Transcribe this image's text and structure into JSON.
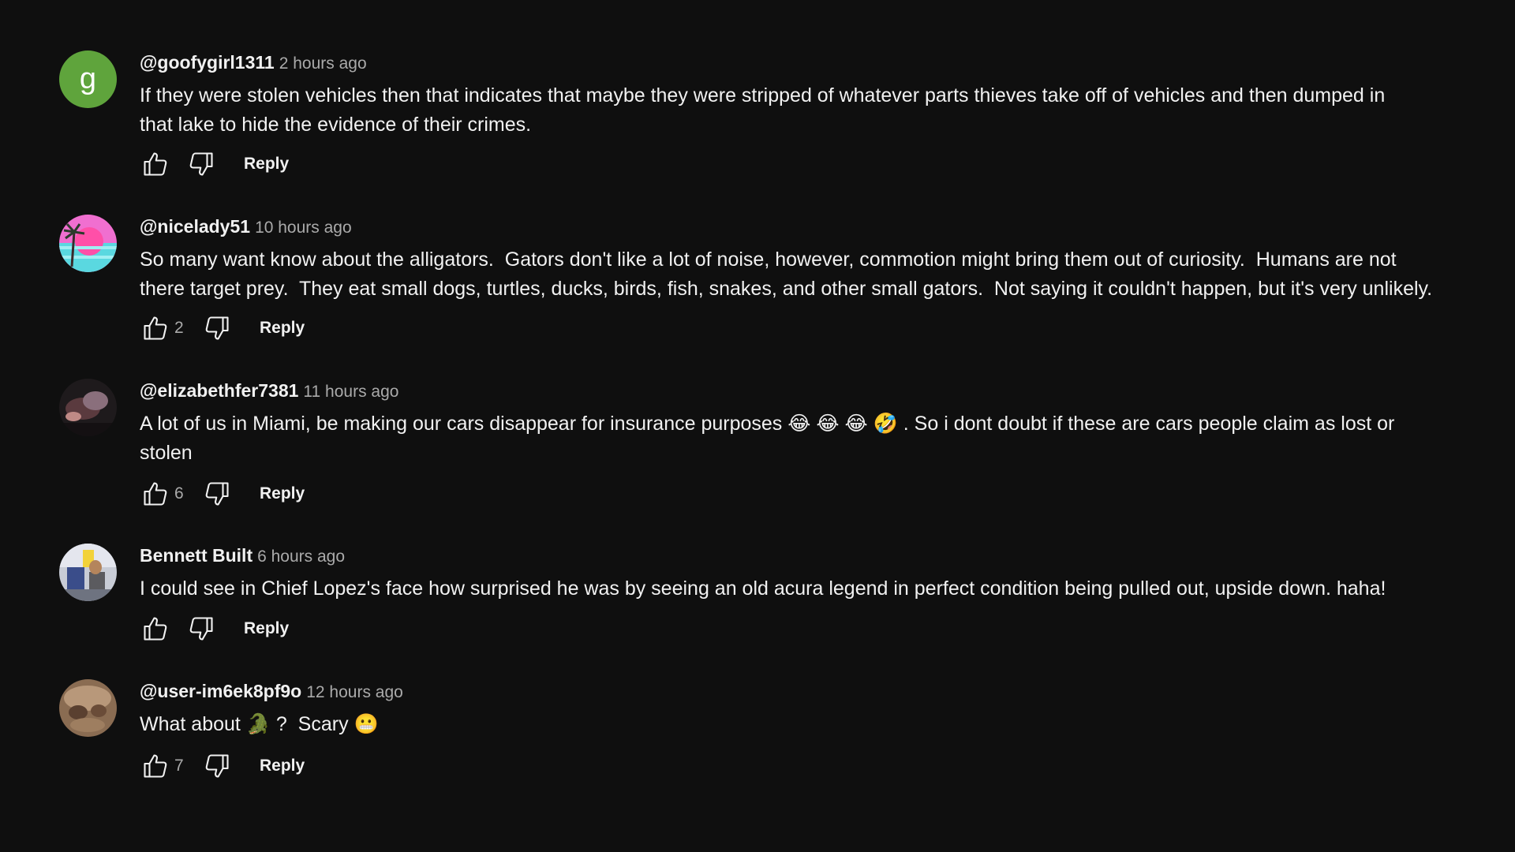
{
  "comments": [
    {
      "author": "@goofygirl1311",
      "time": "2 hours ago",
      "avatar_letter": "g",
      "text_lines": [
        "If they were stolen vehicles then that indicates that maybe they were stripped of whatever parts thieves take off of vehicles and then dumped in",
        "that lake to hide the evidence of their crimes."
      ],
      "like_count": "",
      "reply_label": "Reply"
    },
    {
      "author": "@nicelady51",
      "time": "10 hours ago",
      "text_lines": [
        "So many want know about the alligators.  Gators don't like a lot of noise, however, commotion might bring them out of curiosity.  Humans are not",
        "there target prey.  They eat small dogs, turtles, ducks, birds, fish, snakes, and other small gators.  Not saying it couldn't happen, but it's very unlikely."
      ],
      "like_count": "2",
      "reply_label": "Reply"
    },
    {
      "author": "@elizabethfer7381",
      "time": "11 hours ago",
      "text_lines": [
        "A lot of us in Miami, be making our cars disappear for insurance purposes 😂 😂 😂 🤣 . So i dont doubt if these are cars people claim as lost or",
        "stolen"
      ],
      "like_count": "6",
      "reply_label": "Reply"
    },
    {
      "author": "Bennett Built",
      "time": "6 hours ago",
      "text_lines": [
        "I could see in Chief Lopez's face how surprised he was by seeing an old acura legend in perfect condition being pulled out, upside down. haha!"
      ],
      "like_count": "",
      "reply_label": "Reply"
    },
    {
      "author": "@user-im6ek8pf9o",
      "time": "12 hours ago",
      "text_lines": [
        "What about 🐊 ?  Scary 😬"
      ],
      "like_count": "7",
      "reply_label": "Reply"
    }
  ],
  "icons": {
    "like": "thumbs-up-icon",
    "dislike": "thumbs-down-icon"
  },
  "colors": {
    "background": "#0f0f0f",
    "text": "#f1f1f1",
    "secondary_text": "#aaaaaa",
    "avatar_green": "#5fa43c"
  }
}
